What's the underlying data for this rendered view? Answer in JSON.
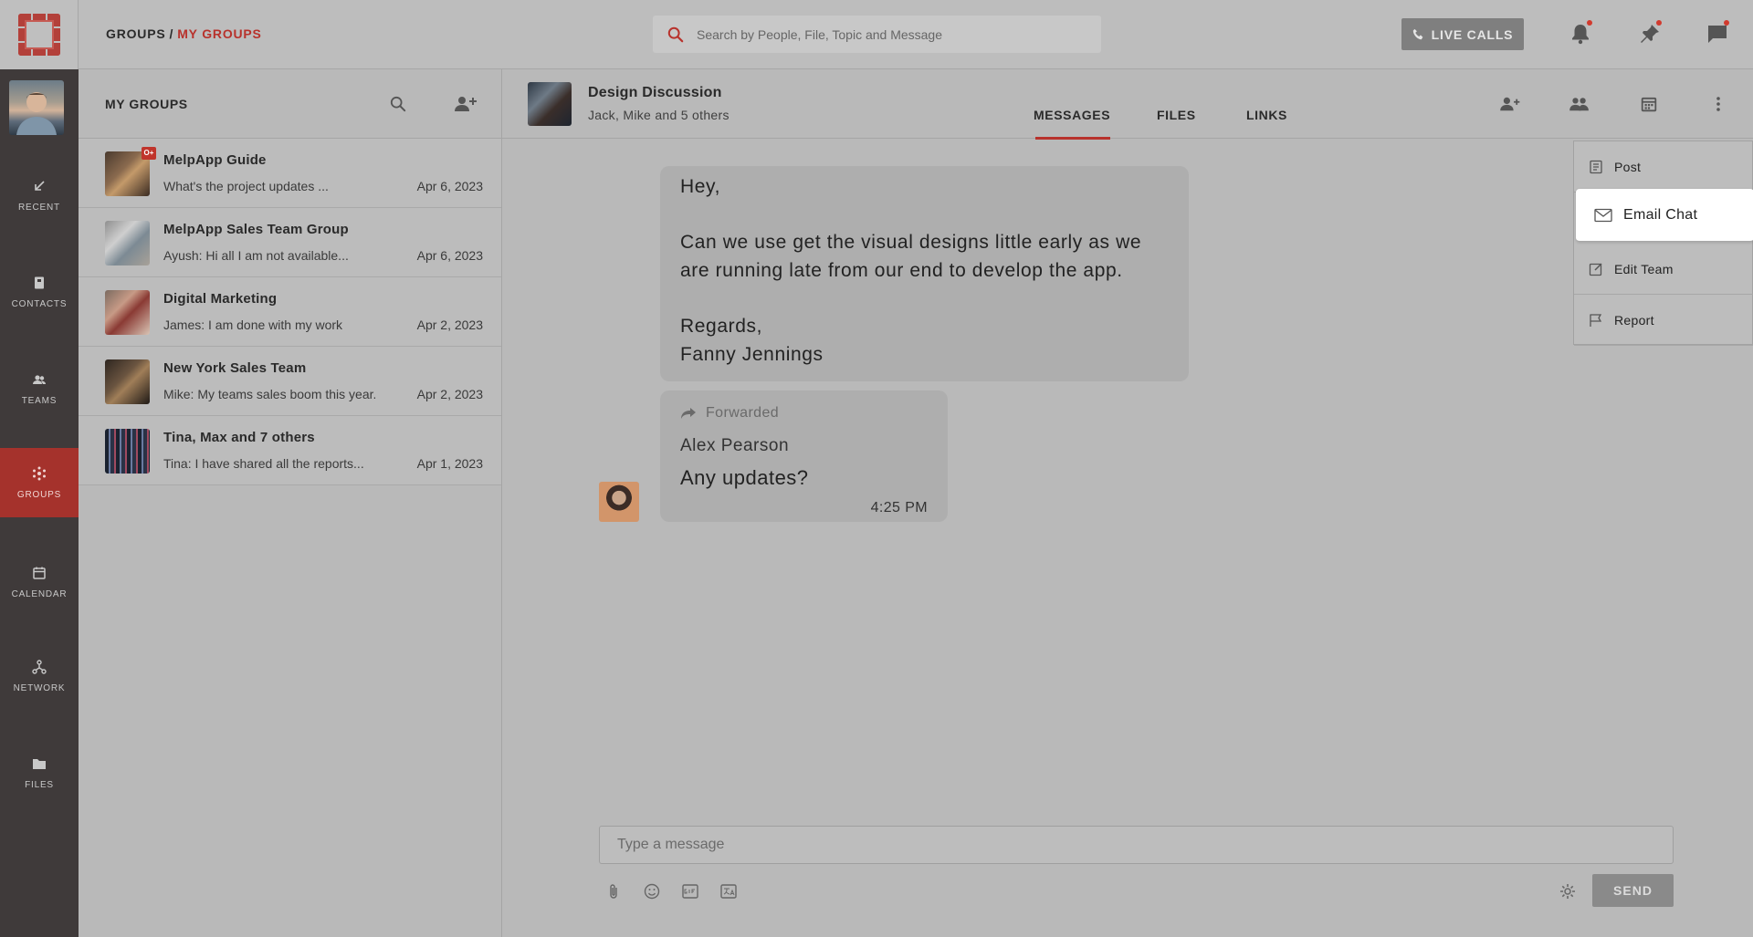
{
  "breadcrumb": {
    "root": "GROUPS",
    "separator": "/",
    "current": "MY GROUPS"
  },
  "search": {
    "placeholder": "Search by People, File, Topic and Message"
  },
  "topbar": {
    "live_calls_label": "LIVE CALLS",
    "accent_color": "#b8322c"
  },
  "nav": {
    "items": [
      {
        "label": "RECENT",
        "icon": "recent-arrow-icon"
      },
      {
        "label": "CONTACTS",
        "icon": "contacts-book-icon"
      },
      {
        "label": "TEAMS",
        "icon": "teams-people-icon"
      },
      {
        "label": "GROUPS",
        "icon": "groups-icon",
        "active": true
      },
      {
        "label": "CALENDAR",
        "icon": "calendar-icon"
      },
      {
        "label": "NETWORK",
        "icon": "network-icon"
      },
      {
        "label": "FILES",
        "icon": "folder-icon"
      }
    ]
  },
  "groups": {
    "title": "MY GROUPS",
    "items": [
      {
        "name": "MelpApp Guide",
        "preview": "What's the project updates ...",
        "date": "Apr 6, 2023",
        "badge": "O+"
      },
      {
        "name": "MelpApp Sales Team Group",
        "preview": "Ayush: Hi all I am not available...",
        "date": "Apr 6, 2023"
      },
      {
        "name": "Digital Marketing",
        "preview": "James: I am done with my work",
        "date": "Apr 2, 2023"
      },
      {
        "name": "New York Sales Team",
        "preview": "Mike: My teams sales boom this year.",
        "date": "Apr 2, 2023"
      },
      {
        "name": "Tina, Max and 7 others",
        "preview": "Tina: I have shared all the reports...",
        "date": "Apr 1, 2023"
      }
    ]
  },
  "chat": {
    "name": "Design Discussion",
    "members": "Jack, Mike and 5 others",
    "tabs": [
      "MESSAGES",
      "FILES",
      "LINKS"
    ],
    "active_tab": "MESSAGES",
    "message_main": "Hey,\n\nCan we use get the visual designs little early as we are running late from our end to develop the app.\n\nRegards,\nFanny Jennings",
    "forwarded": {
      "label": "Forwarded",
      "author": "Alex Pearson",
      "text": "Any updates?",
      "time": "4:25 PM"
    },
    "composer_placeholder": "Type a message",
    "send_label": "SEND"
  },
  "menu": {
    "items": [
      {
        "label": "Post",
        "icon": "post-icon"
      },
      {
        "label": "Email Chat",
        "icon": "mail-icon",
        "highlighted": true
      },
      {
        "label": "Edit Team",
        "icon": "edit-icon"
      },
      {
        "label": "Report",
        "icon": "flag-icon"
      }
    ]
  }
}
